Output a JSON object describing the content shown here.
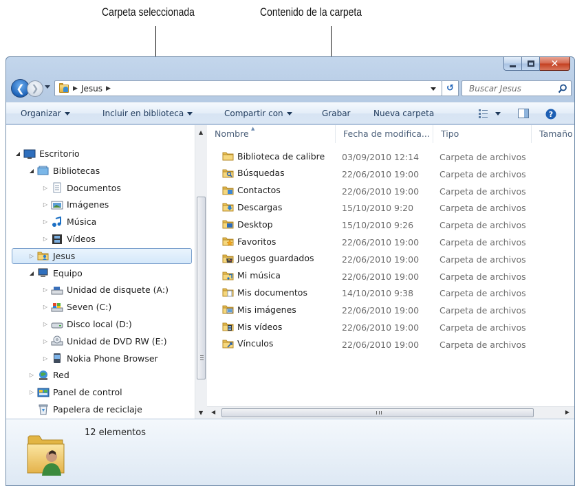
{
  "callouts": {
    "selected_folder": "Carpeta seleccionada",
    "folder_contents": "Contenido de la carpeta"
  },
  "window": {
    "address": {
      "segment": "Jesus"
    },
    "search_placeholder": "Buscar Jesus"
  },
  "toolbar": {
    "organize": "Organizar",
    "include_library": "Incluir en biblioteca",
    "share_with": "Compartir con",
    "burn": "Grabar",
    "new_folder": "Nueva carpeta"
  },
  "nav_tree": [
    {
      "label": "Escritorio",
      "icon": "desktop-icon",
      "level": 0,
      "expander": "open"
    },
    {
      "label": "Bibliotecas",
      "icon": "libraries-icon",
      "level": 1,
      "expander": "open"
    },
    {
      "label": "Documentos",
      "icon": "documents-library-icon",
      "level": 2,
      "expander": "closed"
    },
    {
      "label": "Imágenes",
      "icon": "pictures-library-icon",
      "level": 2,
      "expander": "closed"
    },
    {
      "label": "Música",
      "icon": "music-library-icon",
      "level": 2,
      "expander": "closed"
    },
    {
      "label": "Vídeos",
      "icon": "videos-library-icon",
      "level": 2,
      "expander": "closed"
    },
    {
      "label": "Jesus",
      "icon": "user-folder-icon",
      "level": 1,
      "expander": "closed",
      "selected": true
    },
    {
      "label": "Equipo",
      "icon": "computer-icon",
      "level": 1,
      "expander": "open"
    },
    {
      "label": "Unidad de disquete (A:)",
      "icon": "floppy-drive-icon",
      "level": 2,
      "expander": "closed"
    },
    {
      "label": "Seven (C:)",
      "icon": "system-drive-icon",
      "level": 2,
      "expander": "closed"
    },
    {
      "label": "Disco local (D:)",
      "icon": "hard-drive-icon",
      "level": 2,
      "expander": "closed"
    },
    {
      "label": "Unidad de DVD RW (E:)",
      "icon": "dvd-drive-icon",
      "level": 2,
      "expander": "closed"
    },
    {
      "label": "Nokia Phone Browser",
      "icon": "phone-icon",
      "level": 2,
      "expander": "closed"
    },
    {
      "label": "Red",
      "icon": "network-icon",
      "level": 1,
      "expander": "closed"
    },
    {
      "label": "Panel de control",
      "icon": "control-panel-icon",
      "level": 1,
      "expander": "closed"
    },
    {
      "label": "Papelera de reciclaje",
      "icon": "recycle-bin-icon",
      "level": 1,
      "expander": "none"
    }
  ],
  "columns": {
    "name": "Nombre",
    "date": "Fecha de modifica...",
    "type": "Tipo",
    "size": "Tamaño"
  },
  "files": [
    {
      "name": "Biblioteca de calibre",
      "date": "03/09/2010 12:14",
      "type": "Carpeta de archivos",
      "icon": "folder-icon"
    },
    {
      "name": "Búsquedas",
      "date": "22/06/2010 19:00",
      "type": "Carpeta de archivos",
      "icon": "searches-folder-icon"
    },
    {
      "name": "Contactos",
      "date": "22/06/2010 19:00",
      "type": "Carpeta de archivos",
      "icon": "contacts-folder-icon"
    },
    {
      "name": "Descargas",
      "date": "15/10/2010 9:20",
      "type": "Carpeta de archivos",
      "icon": "downloads-folder-icon"
    },
    {
      "name": "Desktop",
      "date": "15/10/2010 9:26",
      "type": "Carpeta de archivos",
      "icon": "desktop-folder-icon"
    },
    {
      "name": "Favoritos",
      "date": "22/06/2010 19:00",
      "type": "Carpeta de archivos",
      "icon": "favorites-folder-icon"
    },
    {
      "name": "Juegos guardados",
      "date": "22/06/2010 19:00",
      "type": "Carpeta de archivos",
      "icon": "saved-games-folder-icon"
    },
    {
      "name": "Mi música",
      "date": "22/06/2010 19:00",
      "type": "Carpeta de archivos",
      "icon": "music-folder-icon"
    },
    {
      "name": "Mis documentos",
      "date": "14/10/2010 9:38",
      "type": "Carpeta de archivos",
      "icon": "documents-folder-icon"
    },
    {
      "name": "Mis imágenes",
      "date": "22/06/2010 19:00",
      "type": "Carpeta de archivos",
      "icon": "pictures-folder-icon"
    },
    {
      "name": "Mis vídeos",
      "date": "22/06/2010 19:00",
      "type": "Carpeta de archivos",
      "icon": "videos-folder-icon"
    },
    {
      "name": "Vínculos",
      "date": "22/06/2010 19:00",
      "type": "Carpeta de archivos",
      "icon": "links-folder-icon"
    }
  ],
  "details": {
    "count": "12 elementos"
  },
  "colors": {
    "window_frame": "#b9cde6",
    "selection_fill": "#d5e8fa",
    "selection_border": "#7da2ce",
    "close_button": "#c33e1f",
    "folder_yellow": "#e0ae3d"
  }
}
